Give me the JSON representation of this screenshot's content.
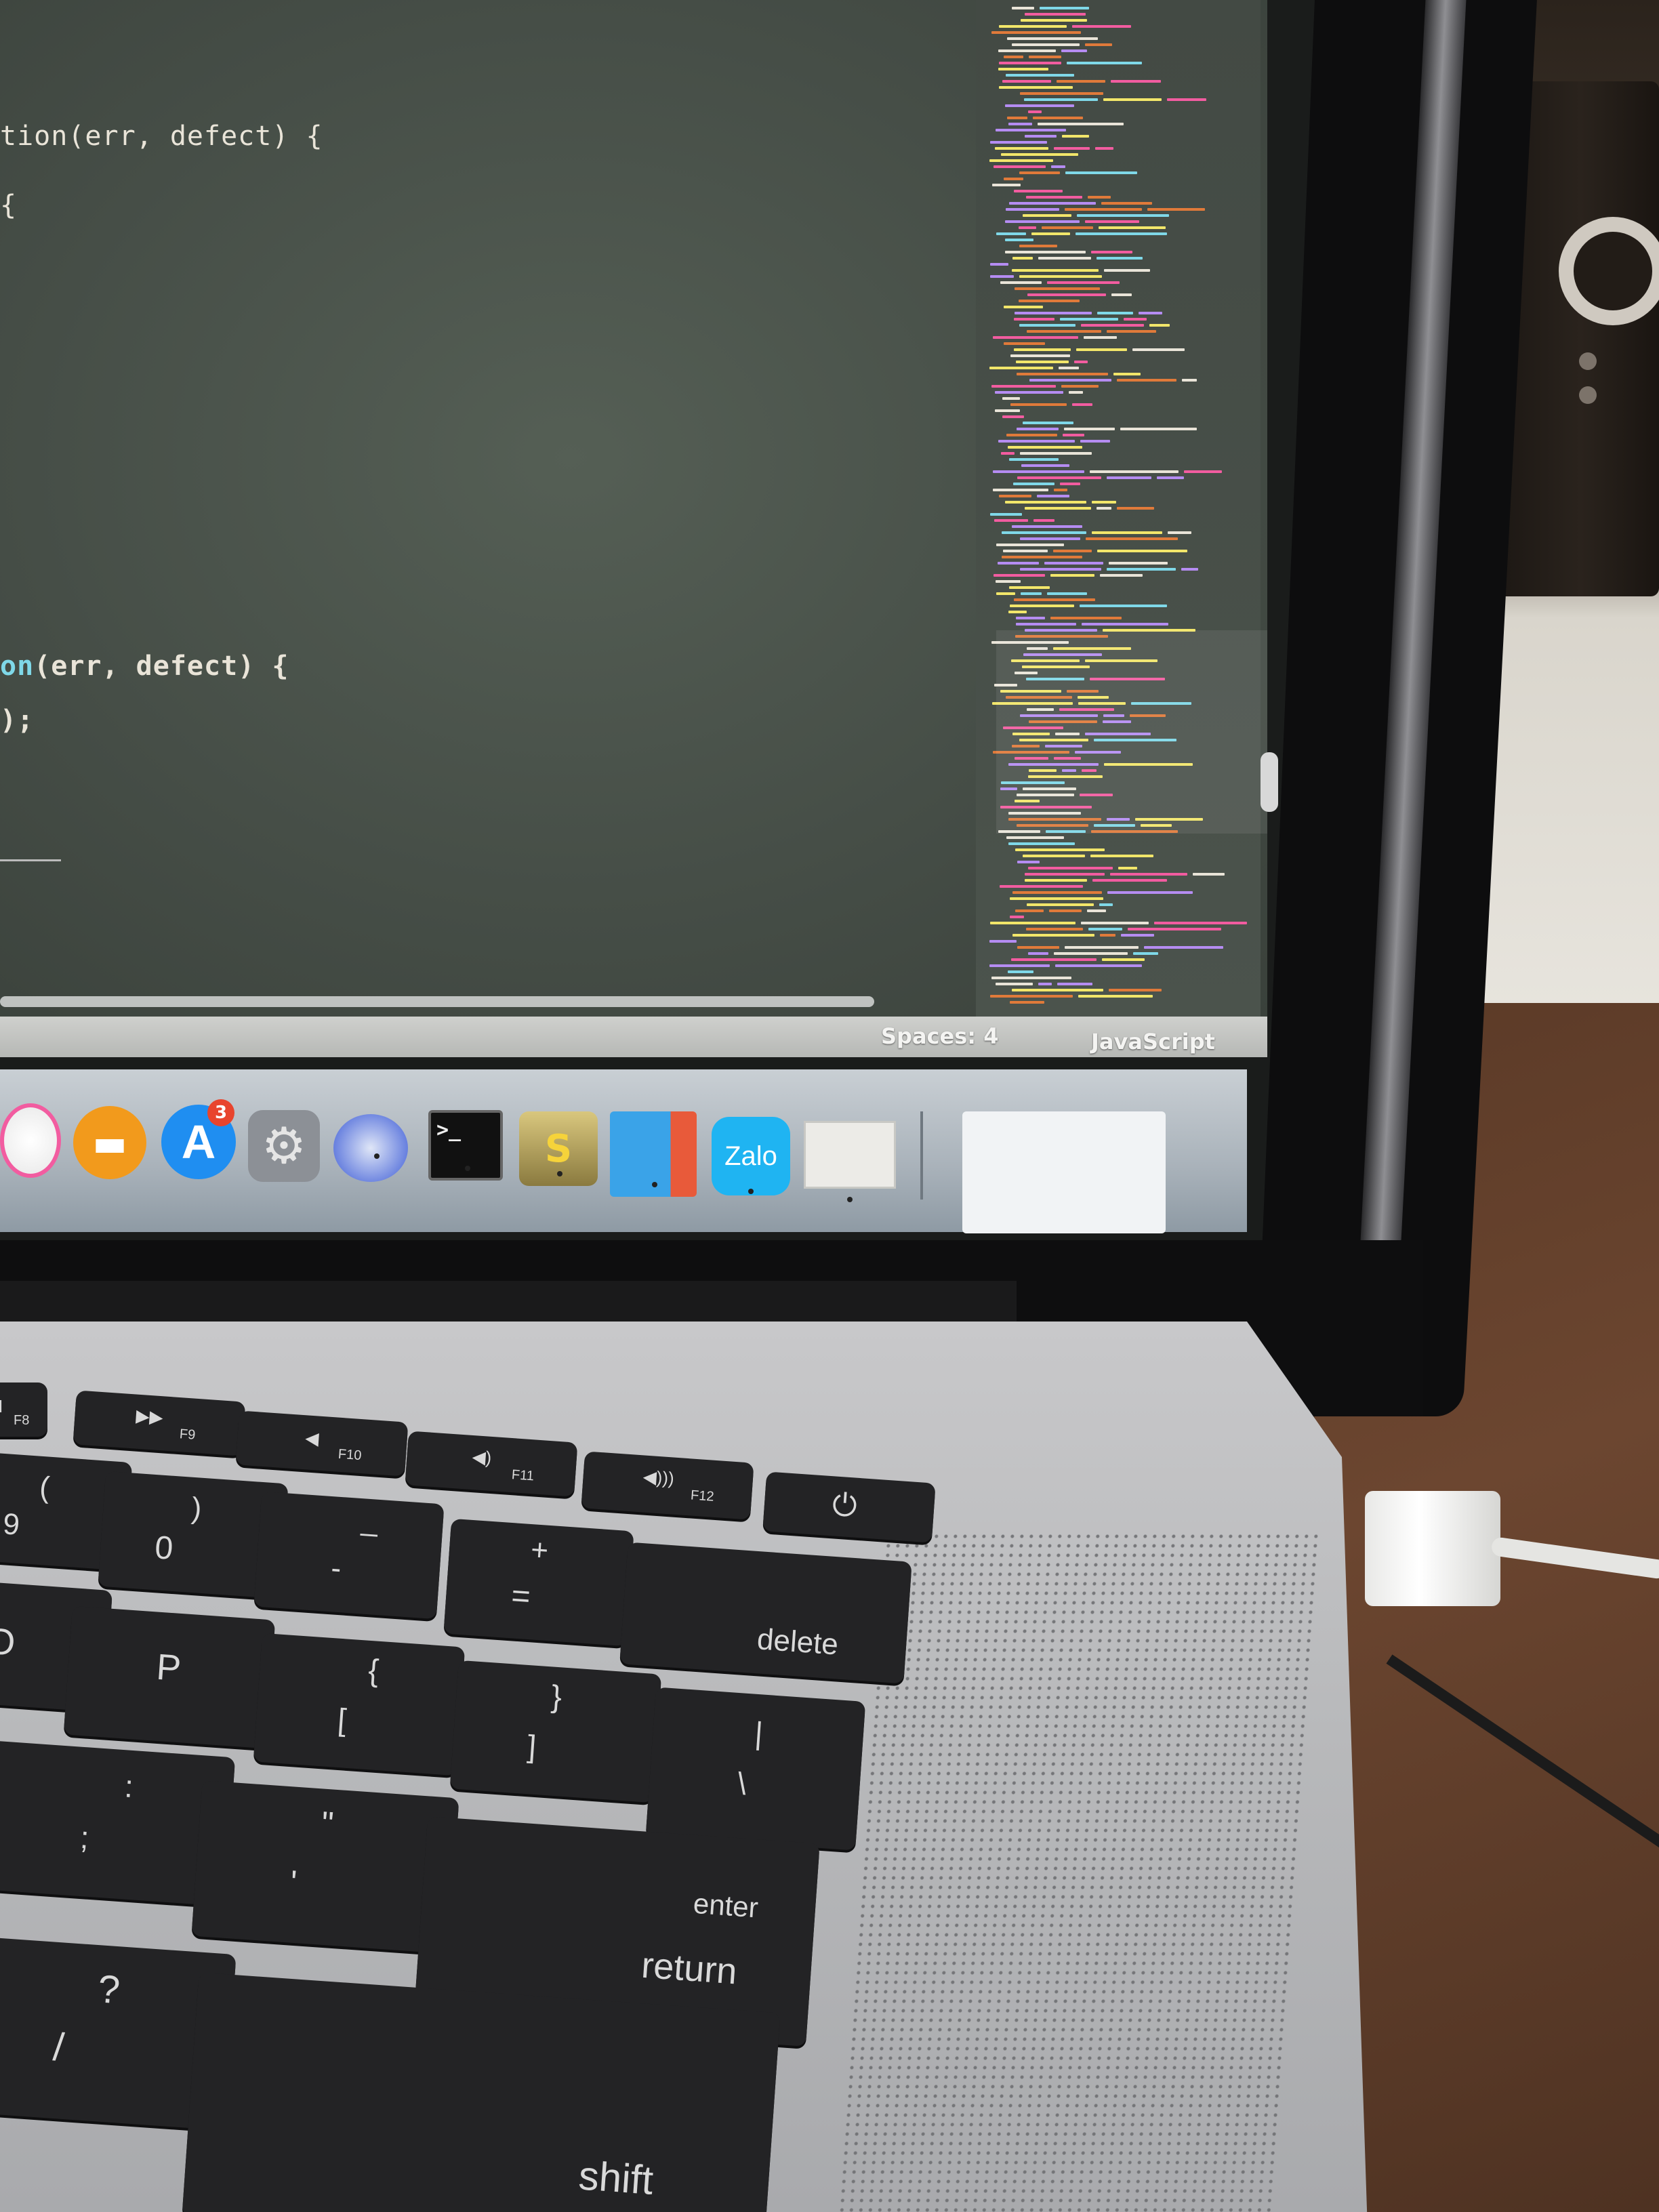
{
  "editor": {
    "code_lines": [
      {
        "prefix": "",
        "fn": "",
        "text": "tion(err, defect) {"
      },
      {
        "prefix": "",
        "fn": "",
        "text": "{"
      },
      {
        "prefix": "",
        "fn": "on",
        "text": "(err, defect) {"
      },
      {
        "prefix": "",
        "fn": "",
        "text": ");"
      }
    ]
  },
  "statusbar": {
    "spaces": "Spaces: 4",
    "syntax": "JavaScript"
  },
  "dock": {
    "items": [
      {
        "name": "itunes-icon",
        "color": "#f2f2f2"
      },
      {
        "name": "ibooks-icon",
        "color": "#f29a1c"
      },
      {
        "name": "app-store-icon",
        "color": "#1f8ef1",
        "badge": "3"
      },
      {
        "name": "system-preferences-icon",
        "color": "#8c9096"
      },
      {
        "name": "bot-app-icon",
        "color": "#3c5bd6"
      },
      {
        "name": "terminal-icon",
        "color": "#111111",
        "label": ">_"
      },
      {
        "name": "sequel-pro-icon",
        "color": "#c9a640"
      },
      {
        "name": "parallels-desktop-icon",
        "color": "#3aa3e8"
      },
      {
        "name": "zalo-icon",
        "color": "#1fb4f2",
        "label": "Zalo"
      },
      {
        "name": "parallels-window-icon",
        "color": "#e9e9e7"
      }
    ]
  },
  "keyboard": {
    "keys": [
      {
        "id": "f8",
        "main": "II",
        "sub": "F8"
      },
      {
        "id": "f9",
        "main": "▶▶",
        "sub": "F9"
      },
      {
        "id": "f10",
        "main": "◀",
        "sub": "F10"
      },
      {
        "id": "f11",
        "main": "◀)",
        "sub": "F11"
      },
      {
        "id": "f12",
        "main": "◀)))",
        "sub": "F12"
      },
      {
        "id": "power",
        "main": "⏻",
        "sub": ""
      },
      {
        "id": "9",
        "main": "(",
        "sub": "9"
      },
      {
        "id": "0",
        "main": ")",
        "sub": "0"
      },
      {
        "id": "minus",
        "main": "_",
        "sub": "-"
      },
      {
        "id": "equals",
        "main": "+",
        "sub": "="
      },
      {
        "id": "delete",
        "main": "delete",
        "sub": ""
      },
      {
        "id": "o",
        "main": "O",
        "sub": ""
      },
      {
        "id": "p",
        "main": "P",
        "sub": ""
      },
      {
        "id": "bracket-left",
        "main": "{",
        "sub": "["
      },
      {
        "id": "bracket-right",
        "main": "}",
        "sub": "]"
      },
      {
        "id": "backslash",
        "main": "|",
        "sub": "\\"
      },
      {
        "id": "semicolon",
        "main": ":",
        "sub": ";"
      },
      {
        "id": "quote",
        "main": "\"",
        "sub": "'"
      },
      {
        "id": "return",
        "main": "enter",
        "sub": "return"
      },
      {
        "id": "slash",
        "main": "?",
        "sub": "/"
      },
      {
        "id": "shift",
        "main": "shift",
        "sub": ""
      }
    ]
  }
}
